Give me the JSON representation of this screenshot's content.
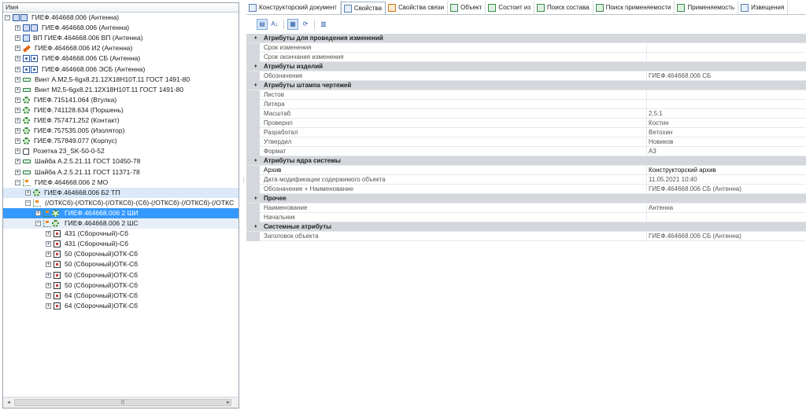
{
  "tree": {
    "header": "Имя",
    "rows": [
      {
        "indent": 0,
        "exp": "−",
        "icon": "root",
        "label": "ГИЕФ.464668.006 (Антенна)"
      },
      {
        "indent": 1,
        "exp": "+",
        "icon": "box",
        "label": "ГИЕФ.464668.006 (Антенна)"
      },
      {
        "indent": 1,
        "exp": "+",
        "icon": "vp",
        "label": "ВП ГИЕФ.464668.006 ВП (Антенна)"
      },
      {
        "indent": 1,
        "exp": "+",
        "icon": "pen",
        "label": "ГИЕФ.464668.006 И2 (Антенна)"
      },
      {
        "indent": 1,
        "exp": "+",
        "icon": "gpbox",
        "label": "ГИЕФ.464668.006 СБ (Антенна)"
      },
      {
        "indent": 1,
        "exp": "+",
        "icon": "gpbox",
        "label": "ГИЕФ.464668.006 ЭСБ (Антенна)"
      },
      {
        "indent": 1,
        "exp": "+",
        "icon": "screw",
        "label": "Винт А.М2,5-6gx8.21.12Х18Н10Т.11 ГОСТ 1491-80"
      },
      {
        "indent": 1,
        "exp": "+",
        "icon": "screw",
        "label": "Винт М2,5-6gx8.21.12Х18Н10Т.11 ГОСТ 1491-80"
      },
      {
        "indent": 1,
        "exp": "+",
        "icon": "gear",
        "label": "ГИЕФ.715141.064 (Втулка)"
      },
      {
        "indent": 1,
        "exp": "+",
        "icon": "gear",
        "label": "ГИЕФ.741128.634 (Поршень)"
      },
      {
        "indent": 1,
        "exp": "+",
        "icon": "gear",
        "label": "ГИЕФ.757471.252 (Контакт)"
      },
      {
        "indent": 1,
        "exp": "+",
        "icon": "gear",
        "label": "ГИЕФ.757535.005 (Изолятор)"
      },
      {
        "indent": 1,
        "exp": "+",
        "icon": "gear",
        "label": "ГИЕФ.757849.077 (Корпус)"
      },
      {
        "indent": 1,
        "exp": "+",
        "icon": "plug",
        "label": "Розетка 23_SK-50-0-52"
      },
      {
        "indent": 1,
        "exp": "+",
        "icon": "screw",
        "label": "Шайба А.2.5.21.11 ГОСТ 10450-78"
      },
      {
        "indent": 1,
        "exp": "+",
        "icon": "screw",
        "label": "Шайба А.2.5.21.11 ГОСТ 11371-78"
      },
      {
        "indent": 1,
        "exp": "−",
        "icon": "tree",
        "label": "ГИЕФ.464668.006 2 МО"
      },
      {
        "indent": 2,
        "exp": "+",
        "icon": "gear",
        "label": "ГИЕФ.464668.006 Б2 ТП",
        "state": "hover-blue"
      },
      {
        "indent": 2,
        "exp": "−",
        "icon": "tree",
        "label": "(/ОТКСб)-(/ОТКСб)-(/ОТКСб)-(Сб)-(/ОТКСб)-(/ОТКСб)-(/ОТКС"
      },
      {
        "indent": 3,
        "exp": "+",
        "icon": "treegear",
        "label": "ГИЕФ.464668.006 2 ШИ",
        "state": "selected"
      },
      {
        "indent": 3,
        "exp": "−",
        "icon": "treegear",
        "label": "ГИЕФ.464668.006 2 ШС",
        "state": "selected-light"
      },
      {
        "indent": 4,
        "exp": "+",
        "icon": "redbox",
        "label": "431 (Сборочный)-Сб"
      },
      {
        "indent": 4,
        "exp": "+",
        "icon": "redbox",
        "label": "431 (Сборочный)-Сб"
      },
      {
        "indent": 4,
        "exp": "+",
        "icon": "redbox",
        "label": "50 (Сборочный)ОТК-Сб"
      },
      {
        "indent": 4,
        "exp": "+",
        "icon": "redbox",
        "label": "50 (Сборочный)ОТК-Сб"
      },
      {
        "indent": 4,
        "exp": "+",
        "icon": "redbox",
        "label": "50 (Сборочный)ОТК-Сб"
      },
      {
        "indent": 4,
        "exp": "+",
        "icon": "redbox",
        "label": "50 (Сборочный)ОТК-Сб"
      },
      {
        "indent": 4,
        "exp": "+",
        "icon": "redbox",
        "label": "64 (Сборочный)ОТК-Сб"
      },
      {
        "indent": 4,
        "exp": "+",
        "icon": "redbox",
        "label": "64 (Сборочный)ОТК-Сб"
      }
    ],
    "scroll_left": "◂",
    "scroll_thumb": "|||",
    "scroll_right": "▸"
  },
  "tabs": [
    {
      "label": "Конструкторский документ",
      "icon": "doc-icon",
      "color": "blue"
    },
    {
      "label": "Свойства",
      "icon": "properties-icon",
      "color": "blue",
      "active": true
    },
    {
      "label": "Свойства связи",
      "icon": "link-properties-icon",
      "color": "orange"
    },
    {
      "label": "Объект",
      "icon": "object-icon",
      "color": "mixed"
    },
    {
      "label": "Состоит из",
      "icon": "consists-of-icon",
      "color": "green"
    },
    {
      "label": "Поиск состава",
      "icon": "search-composition-icon",
      "color": "green"
    },
    {
      "label": "Поиск применяемости",
      "icon": "search-usage-icon",
      "color": "green"
    },
    {
      "label": "Применяемость",
      "icon": "usage-icon",
      "color": "green"
    },
    {
      "label": "Извещения",
      "icon": "notices-icon",
      "color": "blue"
    }
  ],
  "toolbar": {
    "buttons": [
      {
        "name": "categorized-button",
        "glyph": "▤",
        "active": true
      },
      {
        "name": "sort-alpha-button",
        "glyph": "A↓"
      },
      {
        "name": "sep"
      },
      {
        "name": "property-pages-button",
        "glyph": "▦",
        "active": true
      },
      {
        "name": "refresh-button",
        "glyph": "⟳"
      },
      {
        "name": "sep"
      },
      {
        "name": "grid-button",
        "glyph": "▥"
      }
    ]
  },
  "grid": [
    {
      "type": "category",
      "label": "Атрибуты для проведения изменений"
    },
    {
      "type": "prop",
      "name": "Срок изменения",
      "value": ""
    },
    {
      "type": "prop",
      "name": "Срок окончания изменения",
      "value": ""
    },
    {
      "type": "category",
      "label": "Атрибуты изделий"
    },
    {
      "type": "prop",
      "name": "Обозначение",
      "value": "ГИЕФ.464668.006 СБ"
    },
    {
      "type": "category",
      "label": "Атрибуты штампа чертежей"
    },
    {
      "type": "prop",
      "name": "Листов",
      "value": ""
    },
    {
      "type": "prop",
      "name": "Литера",
      "value": ""
    },
    {
      "type": "prop",
      "name": "Масштаб",
      "value": "2,5:1"
    },
    {
      "type": "prop",
      "name": "Проверил",
      "value": "Костин"
    },
    {
      "type": "prop",
      "name": "Разработал",
      "value": "Ветохин"
    },
    {
      "type": "prop",
      "name": "Утвердил",
      "value": "Новиков"
    },
    {
      "type": "prop",
      "name": "Формат",
      "value": "А3"
    },
    {
      "type": "category",
      "label": "Атрибуты ядра системы"
    },
    {
      "type": "prop",
      "name": "Архив",
      "value": "Конструкторский архив",
      "bold": true
    },
    {
      "type": "prop",
      "name": "Дата модификации содержимого объекта",
      "value": "11.05.2021 10:40"
    },
    {
      "type": "prop",
      "name": "Обозначение + Наименование",
      "value": "ГИЕФ.464668.006 СБ (Антенна)"
    },
    {
      "type": "category",
      "label": "Прочее"
    },
    {
      "type": "prop",
      "name": "Наименование",
      "value": "Антенна"
    },
    {
      "type": "prop",
      "name": "Начальник",
      "value": ""
    },
    {
      "type": "category",
      "label": "Системные атрибуты"
    },
    {
      "type": "prop",
      "name": "Заголовок объекта",
      "value": "ГИЕФ.464668.006 СБ (Антенна)"
    }
  ],
  "splitter_grip": "⋮"
}
